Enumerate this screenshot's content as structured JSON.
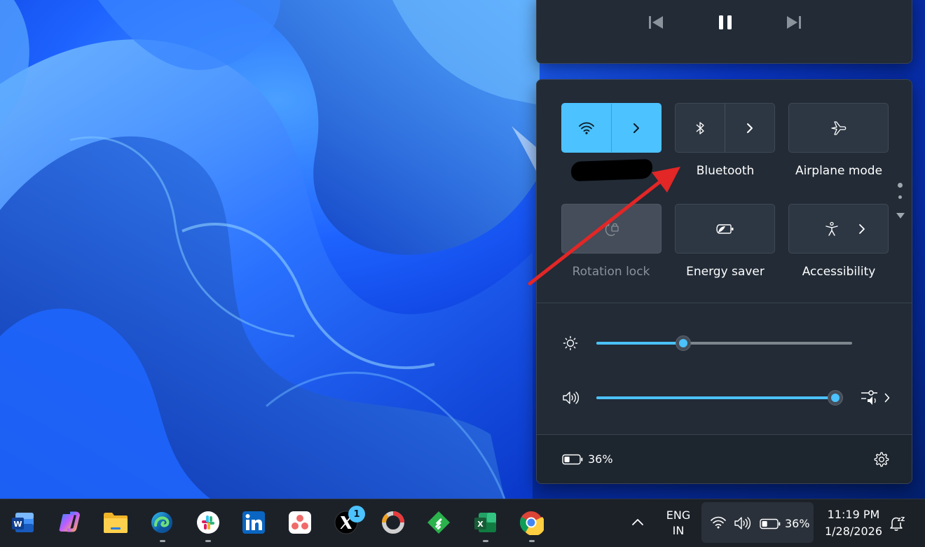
{
  "media": {
    "controls": [
      {
        "name": "previous-track-button",
        "icon": "skip-previous-icon"
      },
      {
        "name": "pause-button",
        "icon": "pause-icon"
      },
      {
        "name": "next-track-button",
        "icon": "skip-next-icon"
      }
    ]
  },
  "quick_settings": {
    "tiles": [
      {
        "id": "wifi",
        "label": "",
        "state": "on",
        "icon": "wifi-icon",
        "has_expand": true
      },
      {
        "id": "bluetooth",
        "label": "Bluetooth",
        "state": "off",
        "icon": "bluetooth-icon",
        "has_expand": true
      },
      {
        "id": "airplane",
        "label": "Airplane mode",
        "state": "off",
        "icon": "airplane-icon",
        "has_expand": false
      },
      {
        "id": "rotation",
        "label": "Rotation lock",
        "state": "disabled",
        "icon": "rotation-lock-icon",
        "has_expand": false
      },
      {
        "id": "energy",
        "label": "Energy saver",
        "state": "off",
        "icon": "energy-saver-icon",
        "has_expand": false
      },
      {
        "id": "accessibility",
        "label": "Accessibility",
        "state": "off",
        "icon": "accessibility-icon",
        "has_expand": true
      }
    ],
    "brightness": {
      "level_percent": 34,
      "icon": "brightness-icon"
    },
    "volume": {
      "level_percent": 97,
      "icon": "speaker-icon",
      "mixer_icon": "volume-mixer-icon"
    },
    "battery": {
      "text": "36%",
      "level_percent": 36,
      "icon": "battery-icon"
    },
    "settings_icon": "gear-icon"
  },
  "taskbar": {
    "apps": [
      {
        "name": "word",
        "icon": "word-icon",
        "running": false
      },
      {
        "name": "copilot",
        "icon": "copilot-icon",
        "running": false
      },
      {
        "name": "file-explorer",
        "icon": "folder-icon",
        "running": false
      },
      {
        "name": "edge",
        "icon": "edge-icon",
        "running": true
      },
      {
        "name": "slack",
        "icon": "slack-icon",
        "running": true
      },
      {
        "name": "linkedin",
        "icon": "linkedin-icon",
        "running": false
      },
      {
        "name": "asana",
        "icon": "asana-icon",
        "running": false
      },
      {
        "name": "x",
        "icon": "x-icon",
        "running": false,
        "badge": "1"
      },
      {
        "name": "loop",
        "icon": "loop-icon",
        "running": false
      },
      {
        "name": "feedly",
        "icon": "feedly-icon",
        "running": false
      },
      {
        "name": "excel",
        "icon": "excel-icon",
        "running": true
      },
      {
        "name": "chrome",
        "icon": "chrome-icon",
        "running": true
      }
    ],
    "language": {
      "line1": "ENG",
      "line2": "IN"
    },
    "tray_battery_text": "36%",
    "clock": {
      "time": "11:19 PM",
      "date": "1/28/2026"
    },
    "notification_icon": "do-not-disturb-icon"
  },
  "colors": {
    "accent": "#4cc2ff",
    "flyout_bg": "#222b36",
    "taskbar_bg": "#1c2128",
    "annotation_arrow": "#e32626"
  }
}
